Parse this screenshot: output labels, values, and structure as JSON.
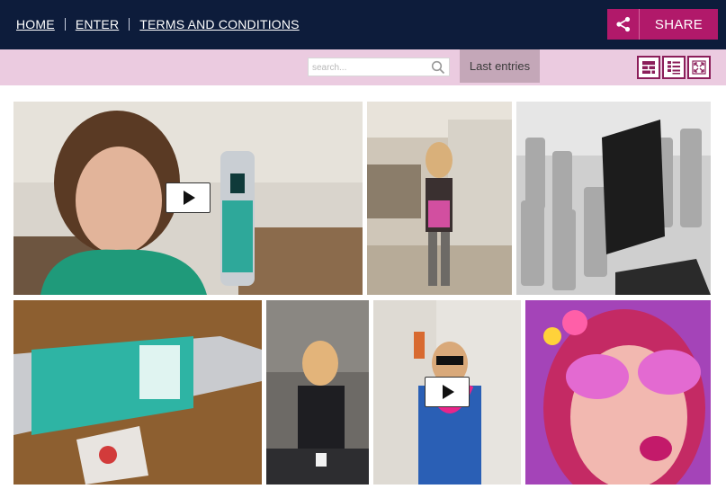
{
  "nav": {
    "items": [
      "HOME",
      "ENTER",
      "TERMS AND CONDITIONS"
    ]
  },
  "share": {
    "label": "SHARE",
    "icon": "share-icon"
  },
  "toolbar": {
    "search_placeholder": "search...",
    "last_entries_label": "Last entries",
    "view_icons": [
      "mosaic-view-icon",
      "list-view-icon",
      "fullscreen-icon"
    ]
  },
  "gallery": {
    "tiles": [
      {
        "kind": "video",
        "subject": "woman holding Funkin cocktail mixer bottle"
      },
      {
        "kind": "photo",
        "subject": "woman dancing in kitchen"
      },
      {
        "kind": "photo",
        "subject": "black and white Funkin bottles display"
      },
      {
        "kind": "photo",
        "subject": "close-up of Funkin mojito bottle"
      },
      {
        "kind": "photo",
        "subject": "woman at bar counter"
      },
      {
        "kind": "video",
        "subject": "woman with sunglasses and lei"
      },
      {
        "kind": "photo",
        "subject": "woman in pink floral glasses"
      }
    ]
  },
  "colors": {
    "topbar": "#0d1c3b",
    "share": "#b1196a",
    "toolbar": "#ebcbe0",
    "accent": "#8b1e5a"
  }
}
